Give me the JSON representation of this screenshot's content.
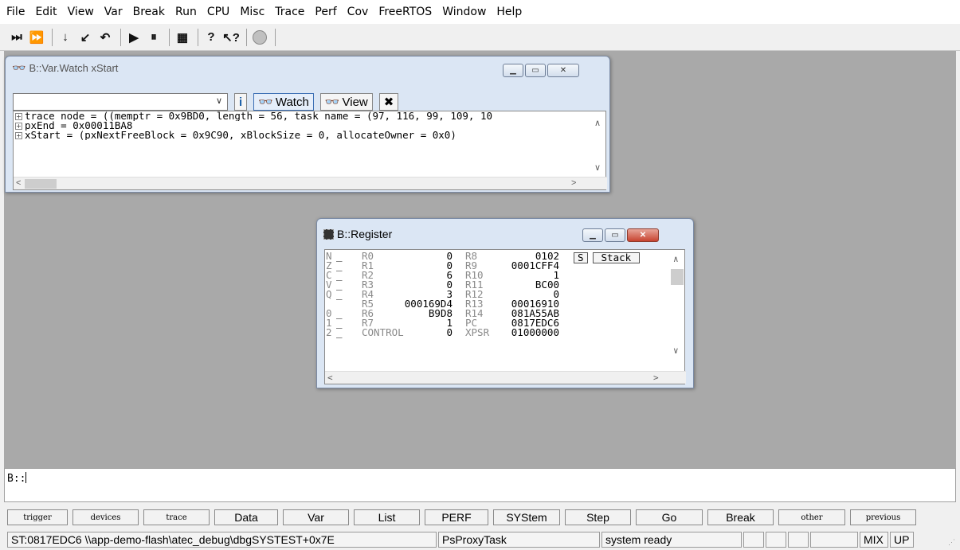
{
  "menu": [
    "File",
    "Edit",
    "View",
    "Var",
    "Break",
    "Run",
    "CPU",
    "Misc",
    "Trace",
    "Perf",
    "Cov",
    "FreeRTOS",
    "Window",
    "Help"
  ],
  "toolbar": {
    "icons": [
      "step-over-icon",
      "step-into-icon",
      "step-down-icon",
      "step-return-icon",
      "go-up-icon",
      "go-icon",
      "break-icon",
      "list-icon",
      "help-icon",
      "context-help-icon",
      "stop-icon"
    ],
    "glyphs": [
      "⏭",
      "⏩",
      "↓",
      "↙",
      "↶",
      "▶",
      "⏸",
      "▦",
      "?",
      "↖?",
      ""
    ]
  },
  "watch_window": {
    "title": "B::Var.Watch xStart",
    "combo_value": "",
    "watch_label": "Watch",
    "view_label": "View",
    "info_glyph": "i",
    "tool_glyph": "✖",
    "lines": [
      "trace_node = ((memptr = 0x9BD0, length = 56, task_name = (97, 116, 99, 109, 10",
      "pxEnd = 0x00011BA8",
      "xStart = (pxNextFreeBlock = 0x9C90, xBlockSize = 0, allocateOwner = 0x0)"
    ]
  },
  "register_window": {
    "title": "B::Register",
    "flags": [
      {
        "flag": "N",
        "val": "_"
      },
      {
        "flag": "Z",
        "val": "_"
      },
      {
        "flag": "C",
        "val": "_"
      },
      {
        "flag": "V",
        "val": "_"
      },
      {
        "flag": "Q",
        "val": "_"
      },
      {
        "flag": "",
        "val": ""
      },
      {
        "flag": "0",
        "val": "_"
      },
      {
        "flag": "1",
        "val": "_"
      },
      {
        "flag": "2",
        "val": "_"
      }
    ],
    "left_regs": [
      {
        "name": "R0",
        "value": "0"
      },
      {
        "name": "R1",
        "value": "0"
      },
      {
        "name": "R2",
        "value": "6"
      },
      {
        "name": "R3",
        "value": "0"
      },
      {
        "name": "R4",
        "value": "3"
      },
      {
        "name": "R5",
        "value": "000169D4"
      },
      {
        "name": "R6",
        "value": "B9D8"
      },
      {
        "name": "R7",
        "value": "1"
      },
      {
        "name": "CONTROL",
        "value": "0"
      }
    ],
    "right_regs": [
      {
        "name": "R8",
        "value": "0102"
      },
      {
        "name": "R9",
        "value": "0001CFF4"
      },
      {
        "name": "R10",
        "value": "1"
      },
      {
        "name": "R11",
        "value": "BC00"
      },
      {
        "name": "R12",
        "value": "0"
      },
      {
        "name": "R13",
        "value": "00016910"
      },
      {
        "name": "R14",
        "value": "081A55AB"
      },
      {
        "name": "PC",
        "value": "0817EDC6"
      },
      {
        "name": "XPSR",
        "value": "01000000"
      }
    ],
    "s_label": "S",
    "stack_label": "Stack"
  },
  "command_line": "B::",
  "softkeys": [
    "trigger",
    "devices",
    "trace",
    "Data",
    "Var",
    "List",
    "PERF",
    "SYStem",
    "Step",
    "Go",
    "Break",
    "other",
    "previous"
  ],
  "status": {
    "address": "ST:0817EDC6  \\\\app-demo-flash\\atec_debug\\dbgSYSTEST+0x7E",
    "task": "PsProxyTask",
    "state": "system ready",
    "mode": "MIX",
    "dir": "UP"
  }
}
